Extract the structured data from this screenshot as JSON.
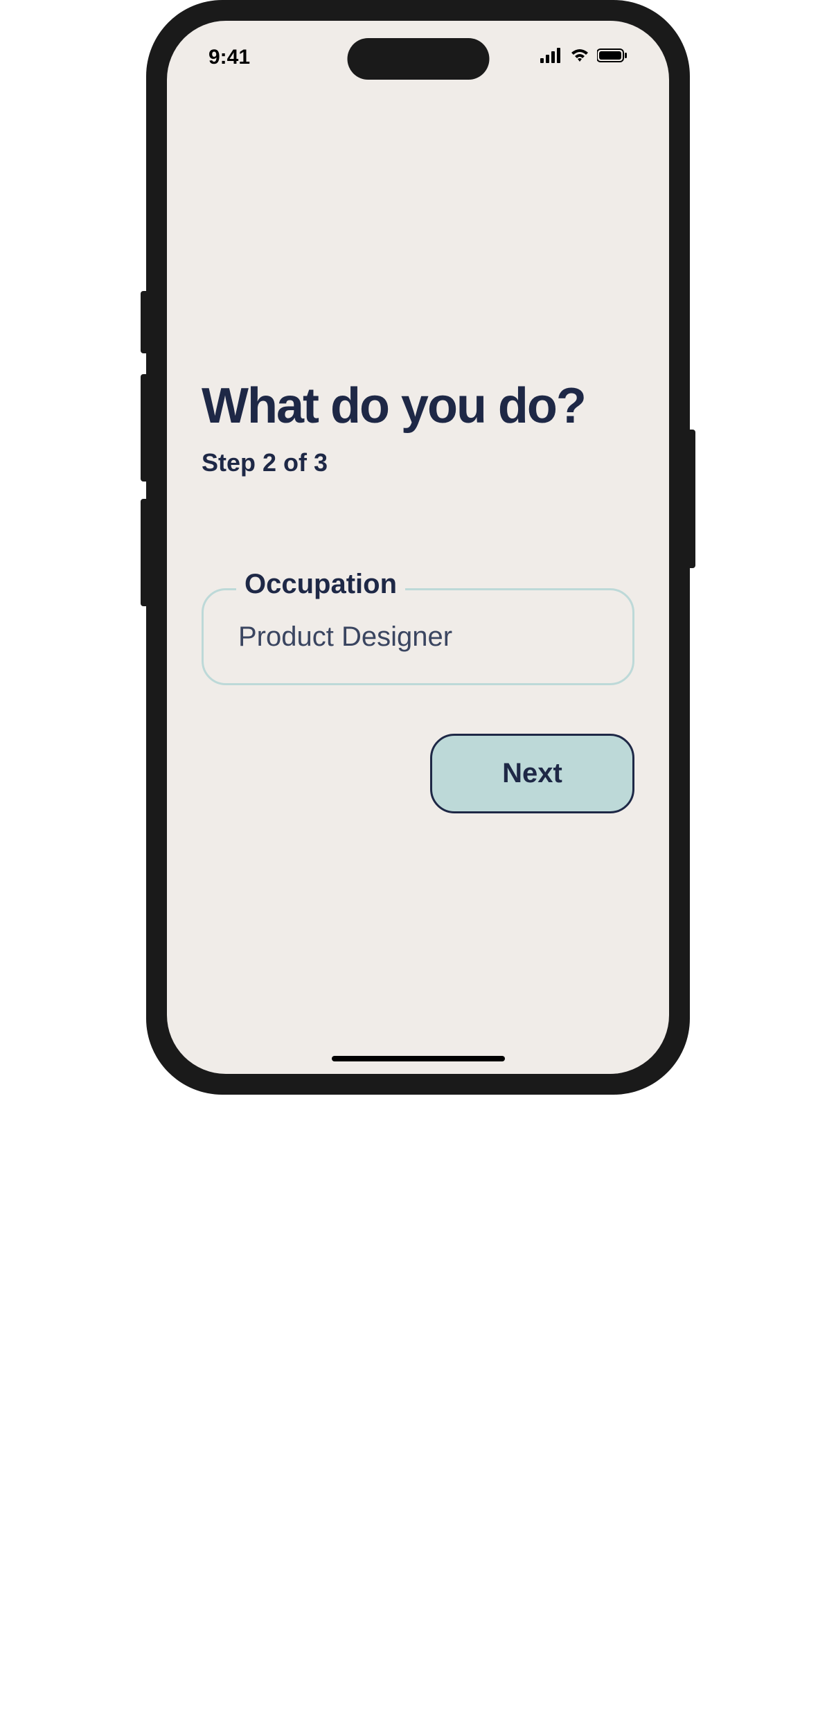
{
  "status_bar": {
    "time": "9:41"
  },
  "content": {
    "title": "What do you do?",
    "step_text": "Step 2 of 3",
    "field_label": "Occupation",
    "field_value": "Product Designer",
    "next_button_label": "Next"
  }
}
